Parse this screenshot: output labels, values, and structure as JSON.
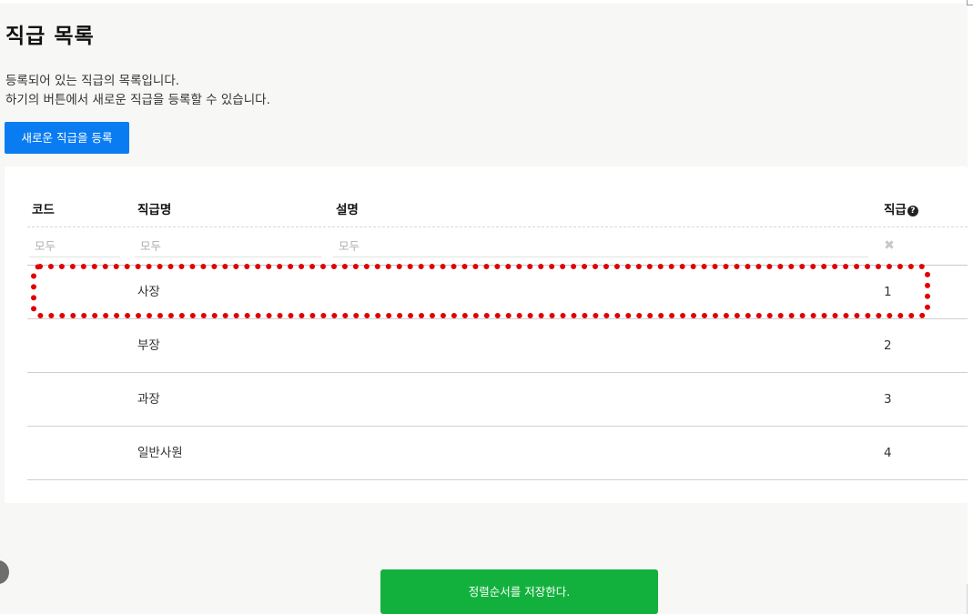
{
  "header": {
    "title": "직급 목록",
    "description_line1": "등록되어 있는 직급의 목록입니다.",
    "description_line2": "하기의 버튼에서 새로운 직급을 등록할 수 있습니다.",
    "new_button_label": "새로운 직급을 등록"
  },
  "table": {
    "columns": {
      "code": "코드",
      "name": "직급명",
      "description": "설명",
      "level": "직급"
    },
    "filters": {
      "code_placeholder": "모두",
      "name_placeholder": "모두",
      "description_placeholder": "모두",
      "clear_icon": "times-icon"
    },
    "rows": [
      {
        "code": "",
        "name": "사장",
        "description": "",
        "level": "1"
      },
      {
        "code": "",
        "name": "부장",
        "description": "",
        "level": "2"
      },
      {
        "code": "",
        "name": "과장",
        "description": "",
        "level": "3"
      },
      {
        "code": "",
        "name": "일반사원",
        "description": "",
        "level": "4"
      }
    ]
  },
  "footer": {
    "save_button_label": "정렬순서를 저장한다."
  },
  "colors": {
    "primary_button": "#0a7cf2",
    "save_button": "#12b13d",
    "highlight_border": "#e00000"
  }
}
